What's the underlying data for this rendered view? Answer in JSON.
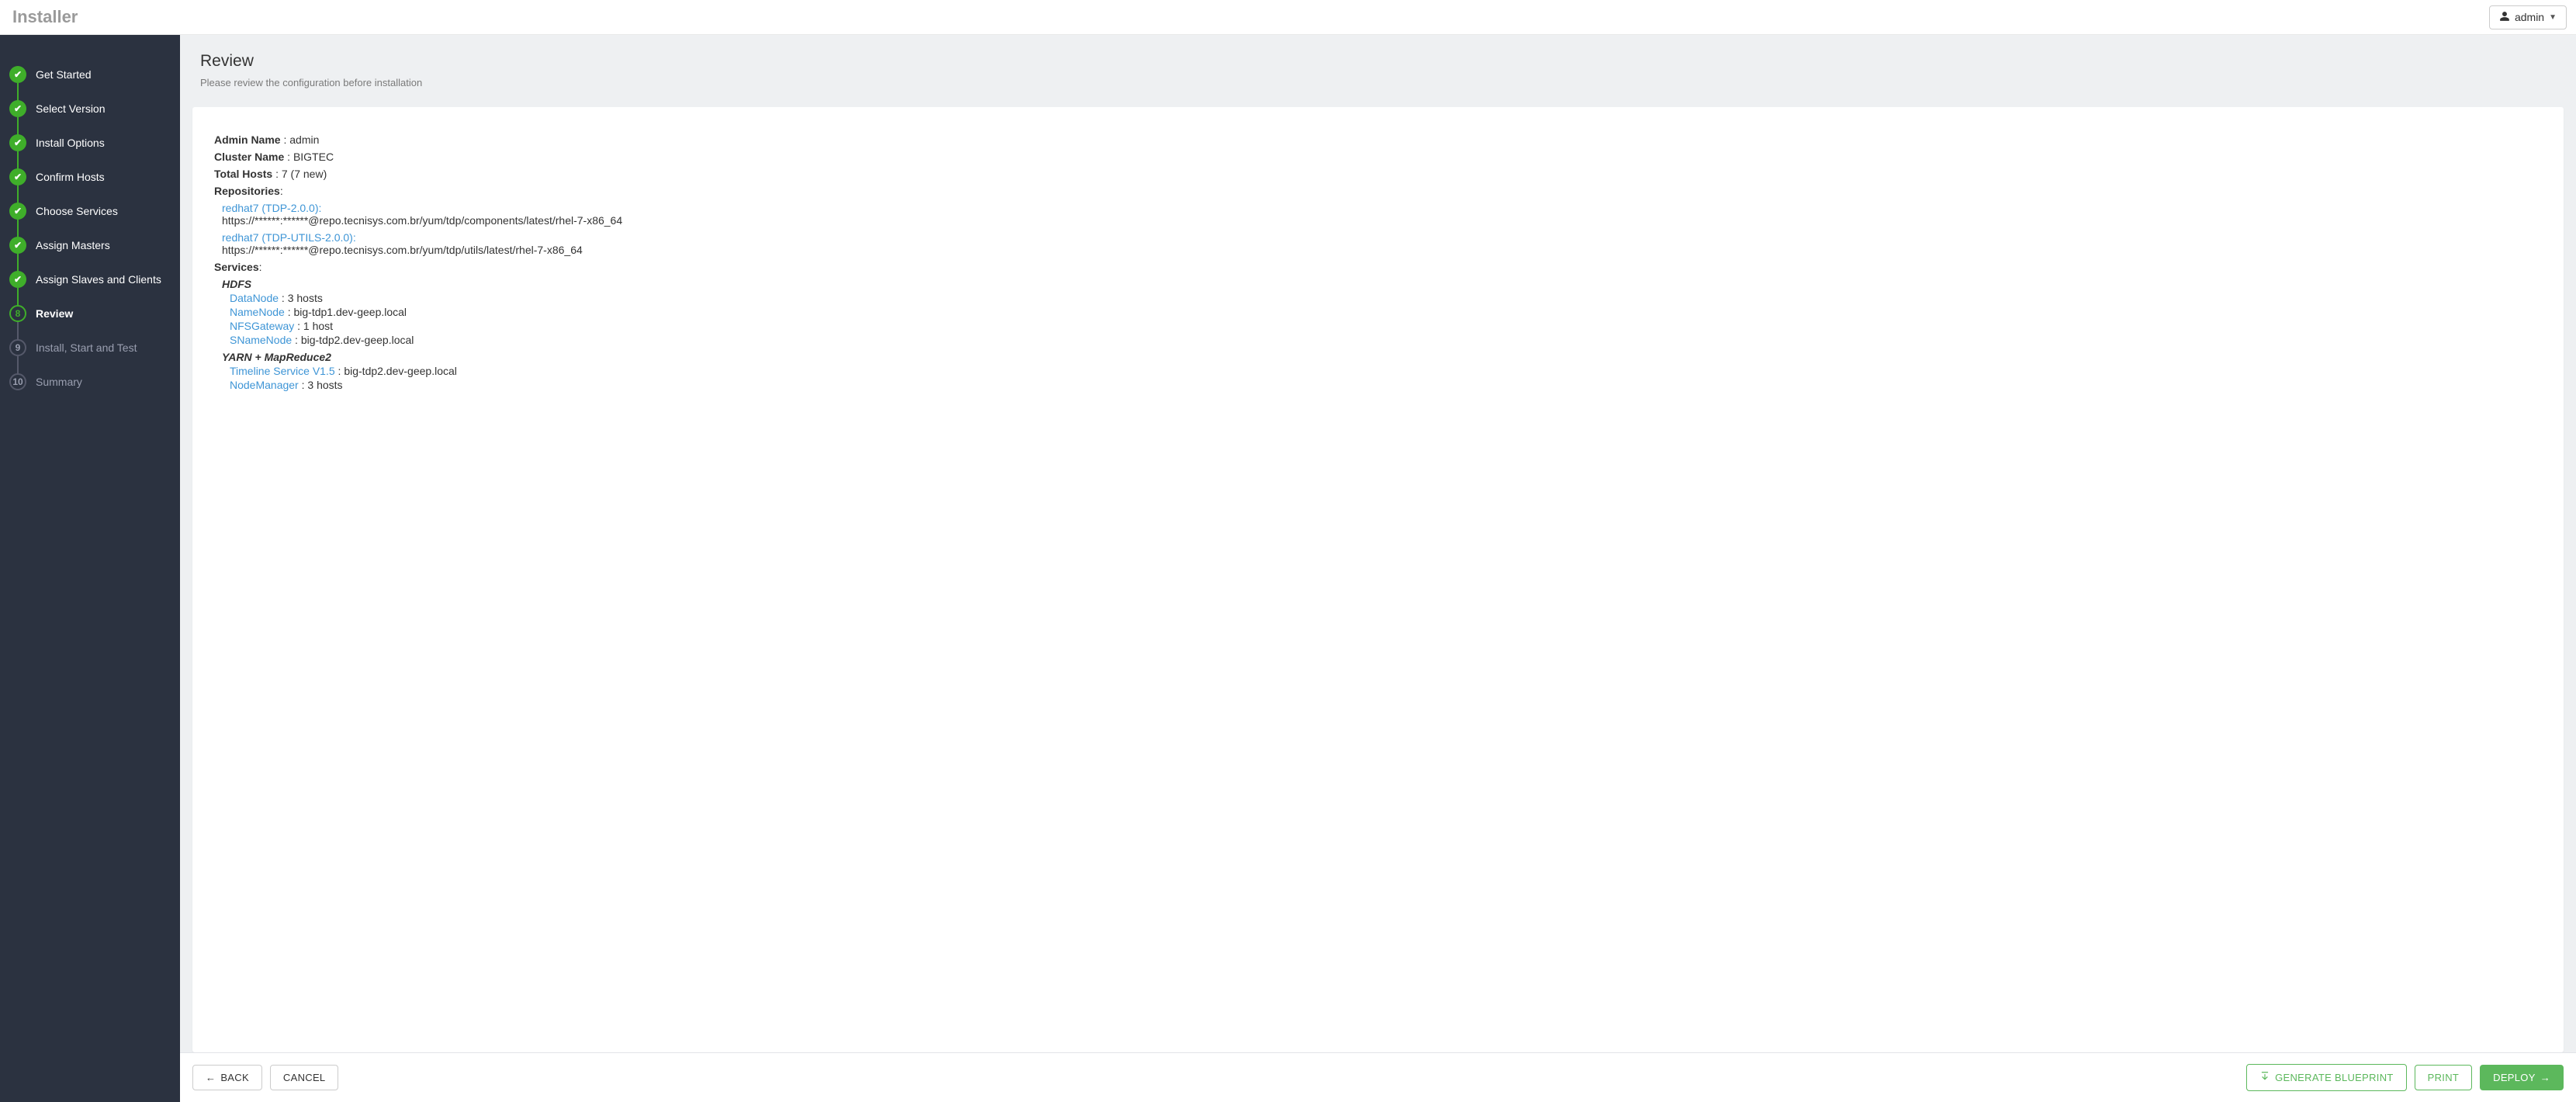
{
  "app": {
    "title": "Installer"
  },
  "user": {
    "name": "admin"
  },
  "sidebar": {
    "steps": [
      {
        "label": "Get Started",
        "state": "completed"
      },
      {
        "label": "Select Version",
        "state": "completed"
      },
      {
        "label": "Install Options",
        "state": "completed"
      },
      {
        "label": "Confirm Hosts",
        "state": "completed"
      },
      {
        "label": "Choose Services",
        "state": "completed"
      },
      {
        "label": "Assign Masters",
        "state": "completed"
      },
      {
        "label": "Assign Slaves and Clients",
        "state": "completed"
      },
      {
        "label": "Review",
        "state": "active",
        "number": "8"
      },
      {
        "label": "Install, Start and Test",
        "state": "pending",
        "number": "9"
      },
      {
        "label": "Summary",
        "state": "pending",
        "number": "10"
      }
    ]
  },
  "page": {
    "title": "Review",
    "subtitle": "Please review the configuration before installation"
  },
  "review": {
    "admin_label": "Admin Name",
    "admin_value": "admin",
    "cluster_label": "Cluster Name",
    "cluster_value": "BIGTEC",
    "hosts_label": "Total Hosts",
    "hosts_value": "7 (7 new)",
    "repos_label": "Repositories",
    "repositories": [
      {
        "name": "redhat7 (TDP-2.0.0):",
        "url": "https://******:******@repo.tecnisys.com.br/yum/tdp/components/latest/rhel-7-x86_64"
      },
      {
        "name": "redhat7 (TDP-UTILS-2.0.0):",
        "url": "https://******:******@repo.tecnisys.com.br/yum/tdp/utils/latest/rhel-7-x86_64"
      }
    ],
    "services_label": "Services",
    "services": [
      {
        "name": "HDFS",
        "components": [
          {
            "name": "DataNode",
            "value": "3 hosts"
          },
          {
            "name": "NameNode",
            "value": "big-tdp1.dev-geep.local"
          },
          {
            "name": "NFSGateway",
            "value": "1 host"
          },
          {
            "name": "SNameNode",
            "value": "big-tdp2.dev-geep.local"
          }
        ]
      },
      {
        "name": "YARN + MapReduce2",
        "components": [
          {
            "name": "Timeline Service V1.5",
            "value": "big-tdp2.dev-geep.local"
          },
          {
            "name": "NodeManager",
            "value": "3 hosts"
          }
        ]
      }
    ]
  },
  "footer": {
    "back": "BACK",
    "cancel": "CANCEL",
    "generate": "GENERATE BLUEPRINT",
    "print": "PRINT",
    "deploy": "DEPLOY"
  }
}
